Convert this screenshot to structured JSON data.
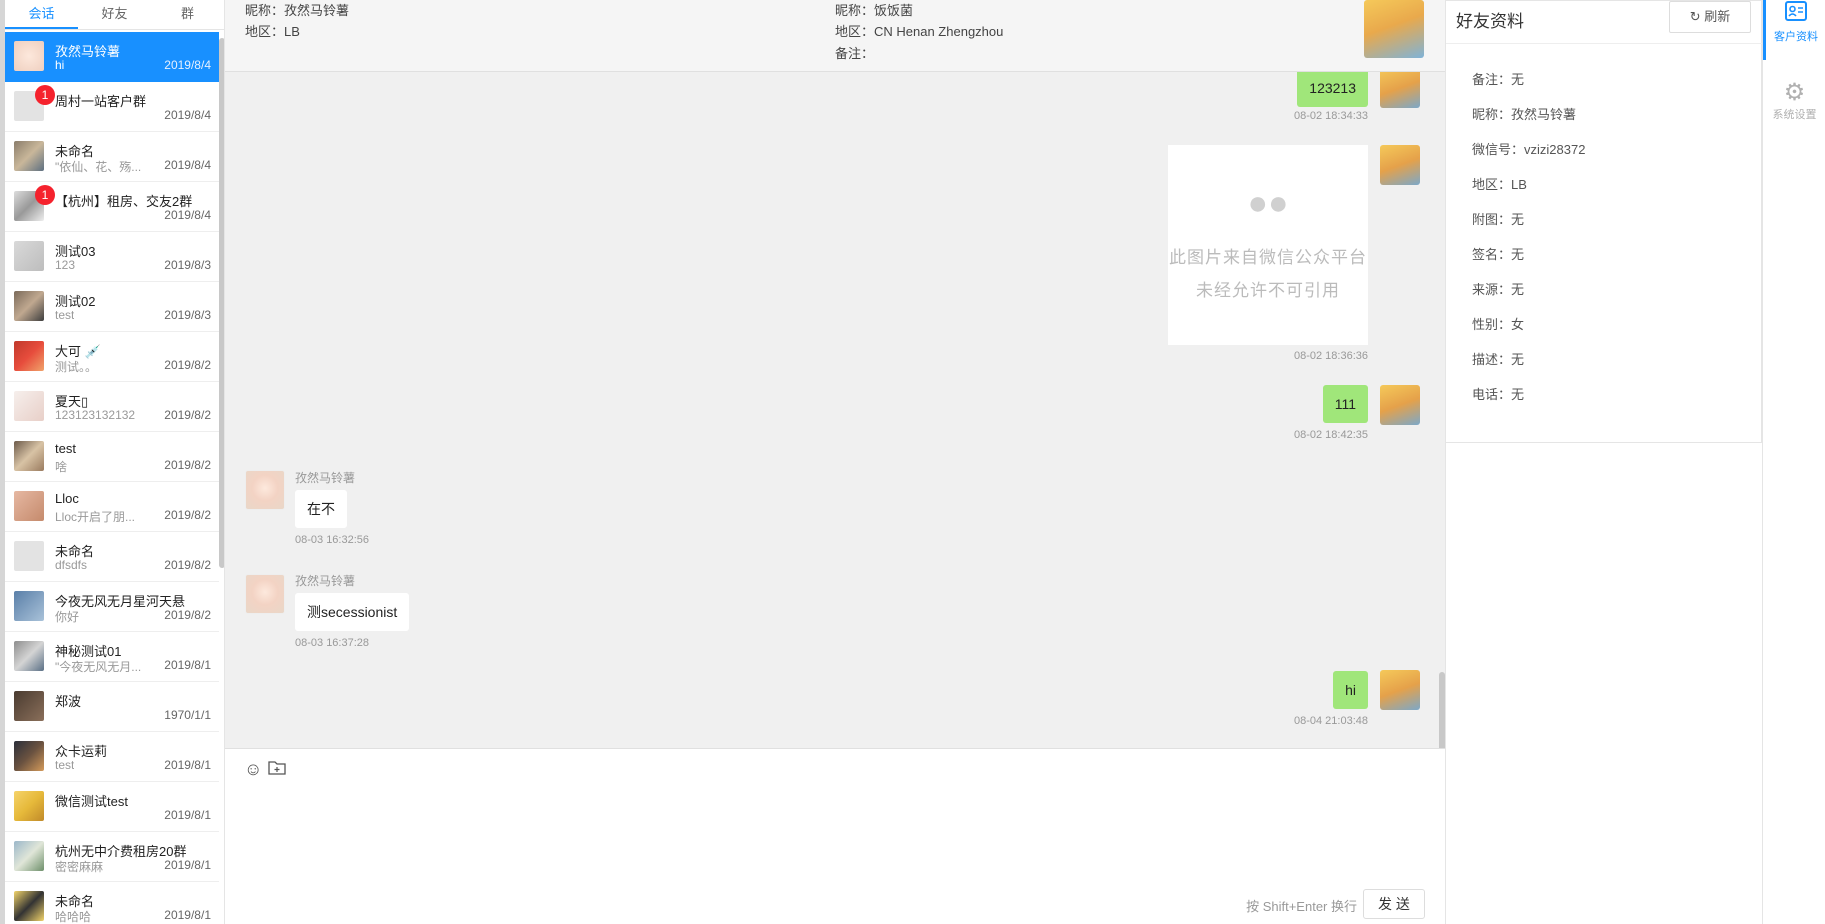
{
  "sidebar": {
    "tabs": [
      {
        "label": "会话"
      },
      {
        "label": "好友"
      },
      {
        "label": "群"
      }
    ],
    "conversations": [
      {
        "name": "孜然马铃薯",
        "preview": "hi",
        "date": "2019/8/4"
      },
      {
        "name": "周村一站客户群",
        "preview": "",
        "date": "2019/8/4",
        "badge": "1"
      },
      {
        "name": "未命名",
        "preview": "\"依仙、花、殇...",
        "date": "2019/8/4"
      },
      {
        "name": "【杭州】租房、交友2群",
        "preview": "",
        "date": "2019/8/4",
        "badge": "1"
      },
      {
        "name": "测试03",
        "preview": "123",
        "date": "2019/8/3"
      },
      {
        "name": "测试02",
        "preview": "test",
        "date": "2019/8/3"
      },
      {
        "name": "大可 💉",
        "preview": "测试。。",
        "date": "2019/8/2"
      },
      {
        "name": "夏天▯",
        "preview": "123123132132",
        "date": "2019/8/2"
      },
      {
        "name": "test",
        "preview": "啥",
        "date": "2019/8/2"
      },
      {
        "name": "Lloc",
        "preview": "Lloc开启了朋...",
        "date": "2019/8/2"
      },
      {
        "name": "未命名",
        "preview": "dfsdfs",
        "date": "2019/8/2"
      },
      {
        "name": "今夜无风无月星河天悬",
        "preview": "你好",
        "date": "2019/8/2"
      },
      {
        "name": "神秘测试01",
        "preview": "\"今夜无风无月...",
        "date": "2019/8/1"
      },
      {
        "name": "郑波",
        "preview": "",
        "date": "1970/1/1"
      },
      {
        "name": "众卡运莉",
        "preview": "test",
        "date": "2019/8/1"
      },
      {
        "name": "微信测试test",
        "preview": "",
        "date": "2019/8/1"
      },
      {
        "name": "杭州无中介费租房20群",
        "preview": "密密麻麻",
        "date": "2019/8/1"
      },
      {
        "name": "未命名",
        "preview": "哈哈哈",
        "date": "2019/8/1"
      }
    ]
  },
  "chat": {
    "header": {
      "my_nickname": "昵称：孜然马铃薯",
      "my_region": "地区：LB",
      "friend_nickname": "昵称：饭饭菌",
      "friend_region": "地区：CN Henan Zhengzhou",
      "friend_remark": "备注："
    },
    "messages": {
      "m1_text": "123213",
      "m1_time": "08-02 18:34:33",
      "m2_img_line1": "此图片来自微信公众平台",
      "m2_img_line2": "未经允许不可引用",
      "m2_time": "08-02 18:36:36",
      "m3_text": "111",
      "m3_time": "08-02 18:42:35",
      "f1_sender": "孜然马铃薯",
      "f1_text": "在不",
      "f1_time": "08-03 16:32:56",
      "f2_sender": "孜然马铃薯",
      "f2_text": "测secessionist",
      "f2_time": "08-03 16:37:28",
      "m4_text": "hi",
      "m4_time": "08-04 21:03:48"
    },
    "composer": {
      "hint": "按 Shift+Enter 换行",
      "send_label": "发 送"
    }
  },
  "profile": {
    "title": "好友资料",
    "refresh_label": "刷新",
    "fields": [
      {
        "text": "备注：无"
      },
      {
        "text": "昵称：孜然马铃薯"
      },
      {
        "text": "微信号：vzizi28372"
      },
      {
        "text": "地区：LB"
      },
      {
        "text": "附图：无"
      },
      {
        "text": "签名：无"
      },
      {
        "text": "来源：无"
      },
      {
        "text": "性别：女"
      },
      {
        "text": "描述：无"
      },
      {
        "text": "电话：无"
      }
    ]
  },
  "nav": {
    "customer_profile": "客户资料",
    "system_settings": "系统设置"
  },
  "colors": {
    "accent": "#1890ff",
    "my_bubble": "#a0e67a",
    "badge": "#f5222d"
  },
  "icons": [
    "smile-icon",
    "folder-icon",
    "refresh-icon",
    "id-card-icon",
    "gear-icon",
    "wechat-icon"
  ]
}
